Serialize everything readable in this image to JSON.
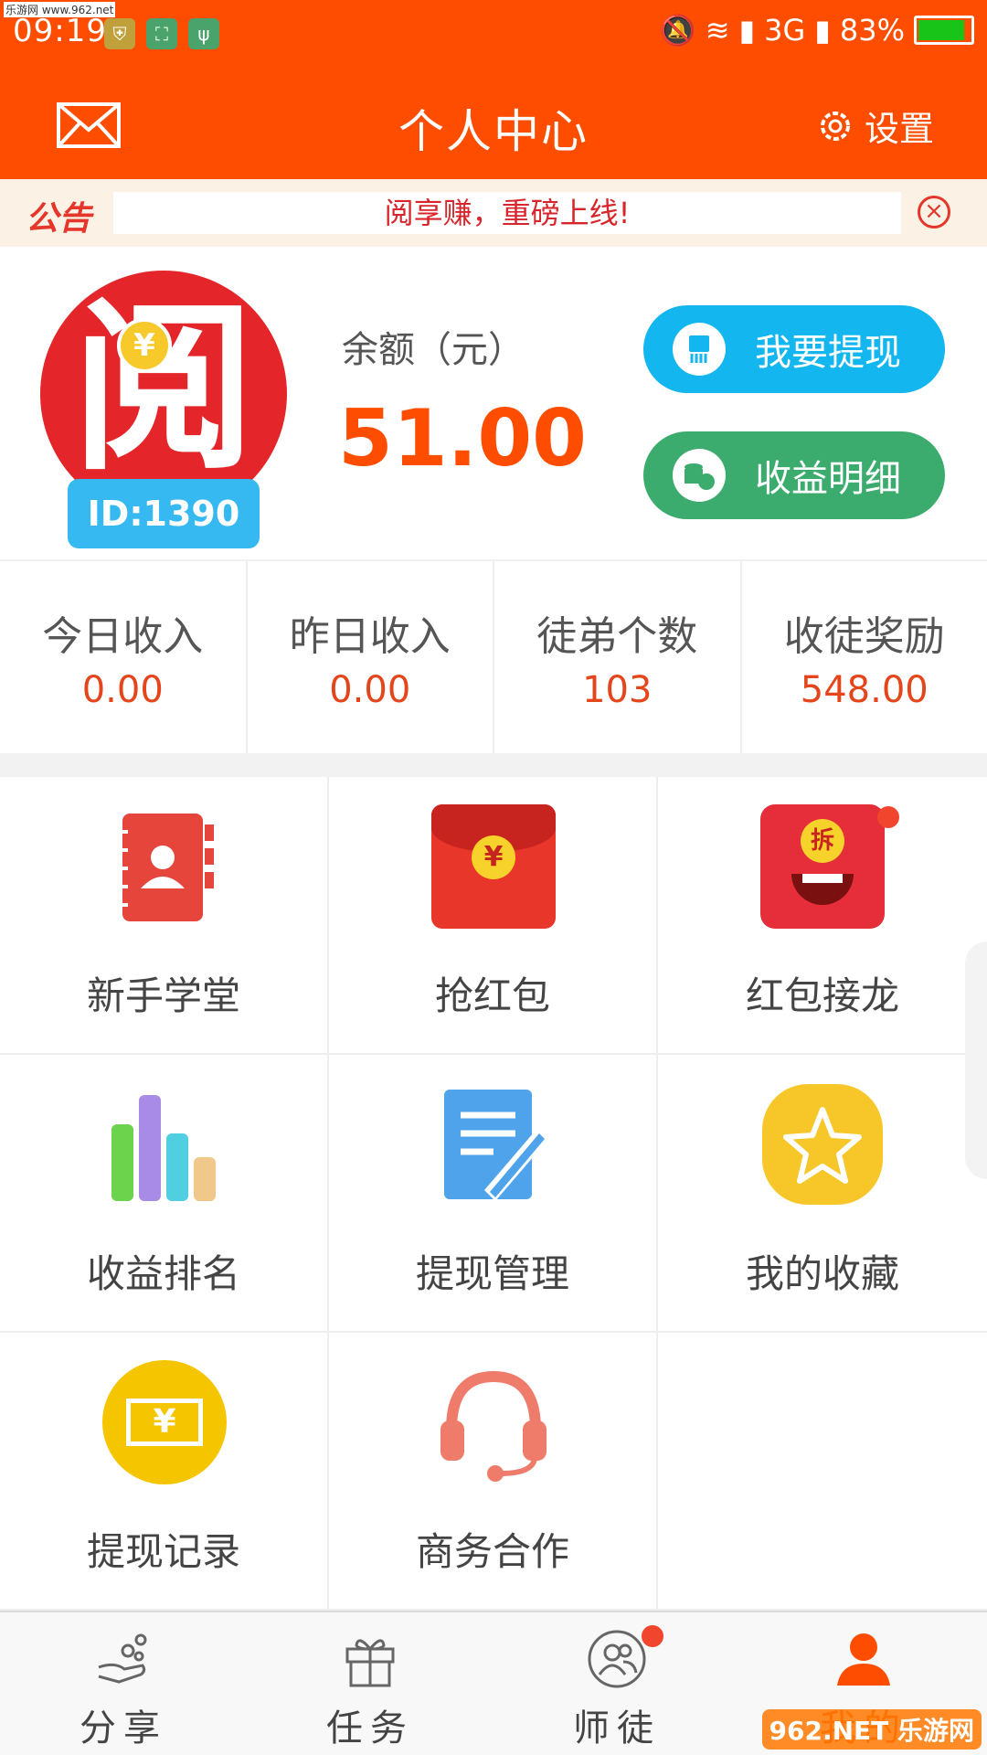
{
  "watermark": "乐游网 www.962.net",
  "watermark_corner": "962.NET 乐游网",
  "status": {
    "time": "09:19",
    "network": "3G",
    "battery": "83%",
    "battery_level": 0.83
  },
  "header": {
    "title": "个人中心",
    "settings_label": "设置"
  },
  "notice": {
    "tag": "公告",
    "text": "阅享赚，重磅上线!",
    "close_glyph": "×"
  },
  "profile": {
    "avatar_char": "阅",
    "coin_glyph": "¥",
    "id_label": "ID:1390",
    "balance_label": "余额（元）",
    "balance_value": "51.00",
    "withdraw_button": "我要提现",
    "detail_button": "收益明细"
  },
  "stats": [
    {
      "label": "今日收入",
      "value": "0.00"
    },
    {
      "label": "昨日收入",
      "value": "0.00"
    },
    {
      "label": "徒弟个数",
      "value": "103"
    },
    {
      "label": "收徒奖励",
      "value": "548.00"
    }
  ],
  "grid": [
    {
      "label": "新手学堂",
      "icon": "notebook-icon"
    },
    {
      "label": "抢红包",
      "icon": "red-envelope-icon",
      "glyph": "¥"
    },
    {
      "label": "红包接龙",
      "icon": "open-envelope-icon",
      "glyph": "拆",
      "badge": true
    },
    {
      "label": "收益排名",
      "icon": "bar-chart-icon"
    },
    {
      "label": "提现管理",
      "icon": "edit-doc-icon"
    },
    {
      "label": "我的收藏",
      "icon": "star-icon"
    },
    {
      "label": "提现记录",
      "icon": "cash-icon",
      "glyph": "¥"
    },
    {
      "label": "商务合作",
      "icon": "headset-icon"
    }
  ],
  "tabs": [
    {
      "label": "分享",
      "icon": "share-icon"
    },
    {
      "label": "任务",
      "icon": "gift-icon",
      "badge": true
    },
    {
      "label": "师徒",
      "icon": "people-icon"
    },
    {
      "label": "我的",
      "icon": "person-icon",
      "active": true
    }
  ],
  "colors": {
    "brand": "#ff4d00",
    "withdraw": "#13b6ef",
    "detail": "#3cac6e",
    "value": "#e5451b"
  }
}
